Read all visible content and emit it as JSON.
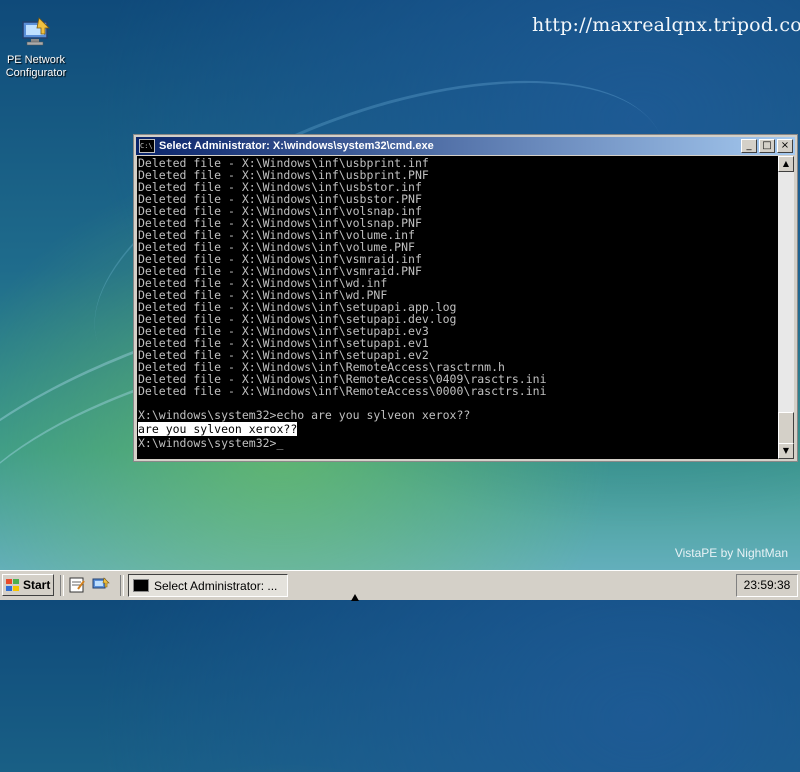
{
  "desktop": {
    "watermark_url": "http://maxrealqnx.tripod.com",
    "brand_text": "VistaPE by NightMan",
    "icons": [
      {
        "label_line1": "PE Network",
        "label_line2": "Configurator",
        "icon": "network-configurator-icon"
      }
    ]
  },
  "cmd_window": {
    "title": "Select Administrator: X:\\windows\\system32\\cmd.exe",
    "buttons": {
      "minimize": "_",
      "maximize": "□",
      "close": "×"
    },
    "output_lines": [
      "Deleted file - X:\\Windows\\inf\\usbprint.inf",
      "Deleted file - X:\\Windows\\inf\\usbprint.PNF",
      "Deleted file - X:\\Windows\\inf\\usbstor.inf",
      "Deleted file - X:\\Windows\\inf\\usbstor.PNF",
      "Deleted file - X:\\Windows\\inf\\volsnap.inf",
      "Deleted file - X:\\Windows\\inf\\volsnap.PNF",
      "Deleted file - X:\\Windows\\inf\\volume.inf",
      "Deleted file - X:\\Windows\\inf\\volume.PNF",
      "Deleted file - X:\\Windows\\inf\\vsmraid.inf",
      "Deleted file - X:\\Windows\\inf\\vsmraid.PNF",
      "Deleted file - X:\\Windows\\inf\\wd.inf",
      "Deleted file - X:\\Windows\\inf\\wd.PNF",
      "Deleted file - X:\\Windows\\inf\\setupapi.app.log",
      "Deleted file - X:\\Windows\\inf\\setupapi.dev.log",
      "Deleted file - X:\\Windows\\inf\\setupapi.ev3",
      "Deleted file - X:\\Windows\\inf\\setupapi.ev1",
      "Deleted file - X:\\Windows\\inf\\setupapi.ev2",
      "Deleted file - X:\\Windows\\inf\\RemoteAccess\\rasctrnm.h",
      "Deleted file - X:\\Windows\\inf\\RemoteAccess\\0409\\rasctrs.ini",
      "Deleted file - X:\\Windows\\inf\\RemoteAccess\\0000\\rasctrs.ini",
      "",
      "X:\\windows\\system32>echo are you sylveon xerox??"
    ],
    "highlighted_line": "are you sylveon xerox??",
    "prompt_line": "X:\\windows\\system32>"
  },
  "taskbar": {
    "start_label": "Start",
    "quick_launch": [
      "notepad-icon",
      "network-icon"
    ],
    "task_button_label": "Select Administrator: ...",
    "clock": "23:59:38"
  }
}
